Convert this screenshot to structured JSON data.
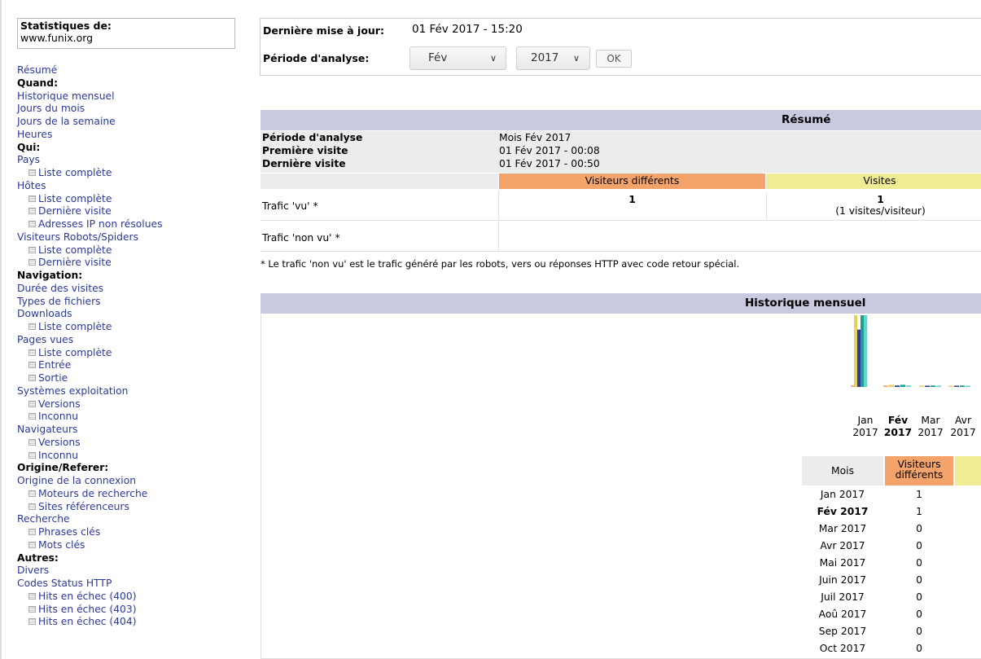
{
  "sidebar": {
    "stats_title": "Statistiques de:",
    "site": "www.funix.org",
    "items": [
      {
        "type": "link",
        "label": "Résumé"
      },
      {
        "type": "head",
        "label": "Quand:"
      },
      {
        "type": "link",
        "label": "Historique mensuel"
      },
      {
        "type": "link",
        "label": "Jours du mois"
      },
      {
        "type": "link",
        "label": "Jours de la semaine"
      },
      {
        "type": "link",
        "label": "Heures"
      },
      {
        "type": "head",
        "label": "Qui:"
      },
      {
        "type": "link",
        "label": "Pays"
      },
      {
        "type": "sub",
        "label": "Liste complète"
      },
      {
        "type": "link",
        "label": "Hôtes"
      },
      {
        "type": "sub",
        "label": "Liste complète"
      },
      {
        "type": "sub",
        "label": "Dernière visite"
      },
      {
        "type": "sub",
        "label": "Adresses IP non résolues"
      },
      {
        "type": "link",
        "label": "Visiteurs Robots/Spiders"
      },
      {
        "type": "sub",
        "label": "Liste complète"
      },
      {
        "type": "sub",
        "label": "Dernière visite"
      },
      {
        "type": "head",
        "label": "Navigation:"
      },
      {
        "type": "link",
        "label": "Durée des visites"
      },
      {
        "type": "link",
        "label": "Types de fichiers"
      },
      {
        "type": "link",
        "label": "Downloads"
      },
      {
        "type": "sub",
        "label": "Liste complète"
      },
      {
        "type": "link",
        "label": "Pages vues"
      },
      {
        "type": "sub",
        "label": "Liste complète"
      },
      {
        "type": "sub",
        "label": "Entrée"
      },
      {
        "type": "sub",
        "label": "Sortie"
      },
      {
        "type": "link",
        "label": "Systèmes exploitation"
      },
      {
        "type": "sub",
        "label": "Versions"
      },
      {
        "type": "sub",
        "label": "Inconnu"
      },
      {
        "type": "link",
        "label": "Navigateurs"
      },
      {
        "type": "sub",
        "label": "Versions"
      },
      {
        "type": "sub",
        "label": "Inconnu"
      },
      {
        "type": "head",
        "label": "Origine/Referer:"
      },
      {
        "type": "link",
        "label": "Origine de la connexion"
      },
      {
        "type": "sub",
        "label": "Moteurs de recherche"
      },
      {
        "type": "sub",
        "label": "Sites référenceurs"
      },
      {
        "type": "link",
        "label": "Recherche"
      },
      {
        "type": "sub",
        "label": "Phrases clés"
      },
      {
        "type": "sub",
        "label": "Mots clés"
      },
      {
        "type": "head",
        "label": "Autres:"
      },
      {
        "type": "link",
        "label": "Divers"
      },
      {
        "type": "link",
        "label": "Codes Status HTTP"
      },
      {
        "type": "sub",
        "label": "Hits en échec (400)"
      },
      {
        "type": "sub",
        "label": "Hits en échec (403)"
      },
      {
        "type": "sub",
        "label": "Hits en échec (404)"
      }
    ]
  },
  "top": {
    "last_update_label": "Dernière mise à jour:",
    "last_update_value": "01 Fév 2017 - 15:20",
    "period_label": "Période d'analyse:",
    "month_selected": "Fév",
    "year_selected": "2017",
    "ok_label": "OK"
  },
  "summary": {
    "title": "Résumé",
    "rows": [
      {
        "label": "Période d'analyse",
        "value": "Mois Fév 2017"
      },
      {
        "label": "Première visite",
        "value": "01 Fév 2017 - 00:08"
      },
      {
        "label": "Dernière visite",
        "value": "01 Fév 2017 - 00:50"
      }
    ],
    "col_visitors": "Visiteurs différents",
    "col_visits": "Visites",
    "traffic_seen_label": "Trafic 'vu' *",
    "traffic_seen_visitors": "1",
    "traffic_seen_visits": "1",
    "traffic_seen_visits_sub": "(1 visites/visiteur)",
    "traffic_unseen_label": "Trafic 'non vu' *",
    "note": "* Le trafic 'non vu' est le trafic généré par les robots, vers ou réponses HTTP avec code retour spécial.",
    "colors": {
      "header": "#c9c9df",
      "visitors": "#f4a46b",
      "visits": "#f0ec96"
    }
  },
  "history": {
    "title": "Historique mensuel",
    "table_headers": {
      "month": "Mois",
      "visitors": "Visiteurs différents"
    },
    "months": [
      {
        "label": "Jan 2017",
        "visitors": "1",
        "bold": false
      },
      {
        "label": "Fév 2017",
        "visitors": "1",
        "bold": true
      },
      {
        "label": "Mar 2017",
        "visitors": "0",
        "bold": false
      },
      {
        "label": "Avr 2017",
        "visitors": "0",
        "bold": false
      },
      {
        "label": "Mai 2017",
        "visitors": "0",
        "bold": false
      },
      {
        "label": "Juin 2017",
        "visitors": "0",
        "bold": false
      },
      {
        "label": "Juil 2017",
        "visitors": "0",
        "bold": false
      },
      {
        "label": "Aoû 2017",
        "visitors": "0",
        "bold": false
      },
      {
        "label": "Sep 2017",
        "visitors": "0",
        "bold": false
      },
      {
        "label": "Oct 2017",
        "visitors": "0",
        "bold": false
      }
    ]
  },
  "chart_data": {
    "type": "bar",
    "categories": [
      "Jan 2017",
      "Fév 2017",
      "Mar 2017",
      "Avr 2017"
    ],
    "x_labels": [
      {
        "month": "Jan",
        "year": "2017",
        "bold": false
      },
      {
        "month": "Fév",
        "year": "2017",
        "bold": true
      },
      {
        "month": "Mar",
        "year": "2017",
        "bold": false
      },
      {
        "month": "Avr",
        "year": "2017",
        "bold": false
      }
    ],
    "series_colors": [
      "#f4a46b",
      "#e8d060",
      "#2a3d9a",
      "#18a090",
      "#6ad0c8"
    ],
    "series": [
      {
        "values": [
          0.02,
          0.02,
          0,
          0
        ]
      },
      {
        "values": [
          1.0,
          0.03,
          0.01,
          0.01
        ]
      },
      {
        "values": [
          0.8,
          0.02,
          0.01,
          0.01
        ]
      },
      {
        "values": [
          1.0,
          0.03,
          0.02,
          0.02
        ]
      },
      {
        "values": [
          1.0,
          0.02,
          0.01,
          0.01
        ]
      }
    ],
    "ylim": [
      0,
      1
    ]
  }
}
